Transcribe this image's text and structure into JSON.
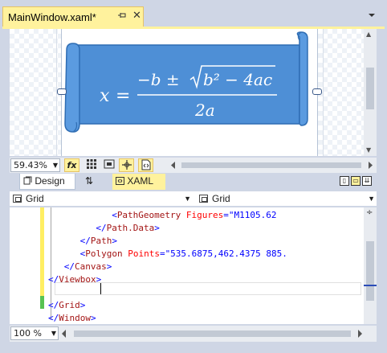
{
  "document_tab": {
    "title": "MainWindow.xaml*",
    "pin_icon": "pin-icon",
    "close_glyph": "✕"
  },
  "designer": {
    "formula": {
      "lhs": "x",
      "equals": "=",
      "numerator_prefix": "−b ± ",
      "radicand": "b² − 4ac",
      "denominator": "2a"
    },
    "banner_color": "#4e8fd6"
  },
  "zoom_toolbar": {
    "zoom_value": "59.43%",
    "fx_label": "fx"
  },
  "split_tabs": {
    "design_label": "Design",
    "swap_glyph": "⇅",
    "xaml_label": "XAML"
  },
  "nav_bar": {
    "left_selector": "Grid",
    "right_selector": "Grid"
  },
  "code_lines": [
    {
      "indent": "            ",
      "open": "<",
      "tag": "PathGeometry",
      "attr": " Figures",
      "eq": "=",
      "val": "\"M1105.62"
    },
    {
      "indent": "         ",
      "open": "</",
      "tag": "Path.Data",
      "close": ">"
    },
    {
      "indent": "      ",
      "open": "</",
      "tag": "Path",
      "close": ">"
    },
    {
      "indent": "      ",
      "open": "<",
      "tag": "Polygon",
      "attr": " Points",
      "eq": "=",
      "val": "\"535.6875,462.4375 885."
    },
    {
      "indent": "   ",
      "open": "</",
      "tag": "Canvas",
      "close": ">"
    },
    {
      "indent": "",
      "open": "</",
      "tag": "Viewbox",
      "close": ">"
    },
    {
      "indent": "",
      "blank": true
    },
    {
      "indent": "",
      "open": "</",
      "tag": "Grid",
      "close": ">"
    },
    {
      "indent": "",
      "open": "</",
      "tag": "Window",
      "close": ">"
    }
  ],
  "bottom_bar": {
    "zoom_value": "100 %"
  },
  "colors": {
    "accent_yellow": "#fff29d",
    "frame": "#cfd6e5",
    "changed_yellow": "#ffee62",
    "saved_green": "#57c252"
  }
}
